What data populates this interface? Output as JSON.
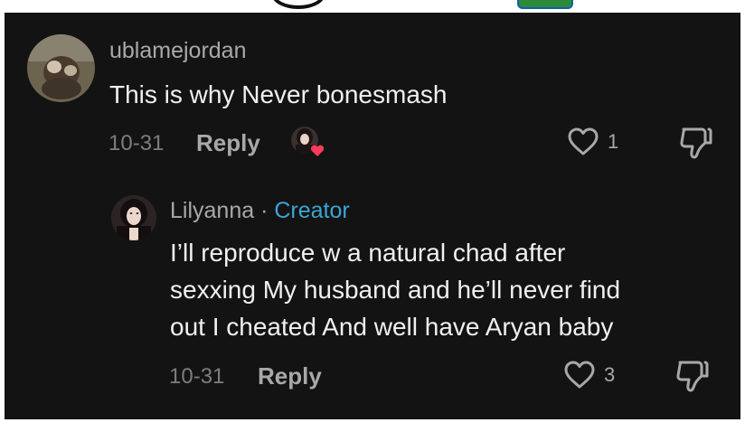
{
  "comment": {
    "username": "ublamejordan",
    "text": "This is why Never bonesmash",
    "date": "10-31",
    "reply_label": "Reply",
    "like_count": "1"
  },
  "reply": {
    "username": "Lilyanna",
    "separator": "·",
    "badge": "Creator",
    "text_lines": [
      "I’ll reproduce w a natural chad after",
      "sexxing My husband and he’ll never find",
      "out I cheated And well have Aryan baby"
    ],
    "date": "10-31",
    "reply_label": "Reply",
    "like_count": "3"
  },
  "colors": {
    "background": "#131313",
    "creator_accent": "#3aa6d3",
    "heart_badge": "#ff3b5c"
  },
  "icons": [
    "heart-outline-icon",
    "dislike-icon",
    "creator-liked-heart-icon"
  ]
}
